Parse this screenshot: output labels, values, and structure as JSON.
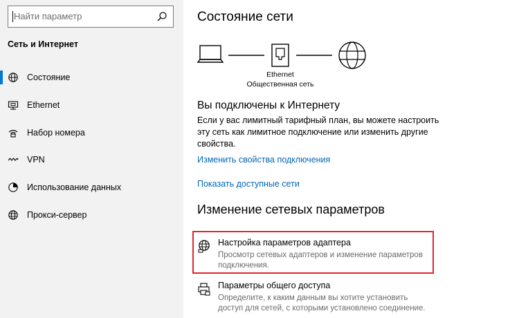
{
  "sidebar": {
    "search_placeholder": "Найти параметр",
    "section_title": "Сеть и Интернет",
    "items": [
      {
        "label": "Состояние",
        "icon": "status-icon"
      },
      {
        "label": "Ethernet",
        "icon": "ethernet-icon"
      },
      {
        "label": "Набор номера",
        "icon": "dialup-icon"
      },
      {
        "label": "VPN",
        "icon": "vpn-icon"
      },
      {
        "label": "Использование данных",
        "icon": "data-usage-icon"
      },
      {
        "label": "Прокси-сервер",
        "icon": "globe-icon"
      }
    ]
  },
  "main": {
    "title": "Состояние сети",
    "diagram": {
      "adapter_name": "Ethernet",
      "network_type": "Общественная сеть"
    },
    "connected_heading": "Вы подключены к Интернету",
    "connected_text": "Если у вас лимитный тарифный план, вы можете настроить эту сеть как лимитное подключение или изменить другие свойства.",
    "link_properties": "Изменить свойства подключения",
    "link_networks": "Показать доступные сети",
    "change_heading": "Изменение сетевых параметров",
    "options": [
      {
        "title": "Настройка параметров адаптера",
        "desc": "Просмотр сетевых адаптеров и изменение параметров подключения.",
        "icon": "adapter-globe-icon"
      },
      {
        "title": "Параметры общего доступа",
        "desc": "Определите, к каким данным вы хотите установить доступ для сетей, с которыми установлено соединение.",
        "icon": "sharing-printer-icon"
      }
    ]
  },
  "colors": {
    "accent": "#0078d7",
    "link": "#0067b8",
    "highlight": "#e1232b"
  }
}
